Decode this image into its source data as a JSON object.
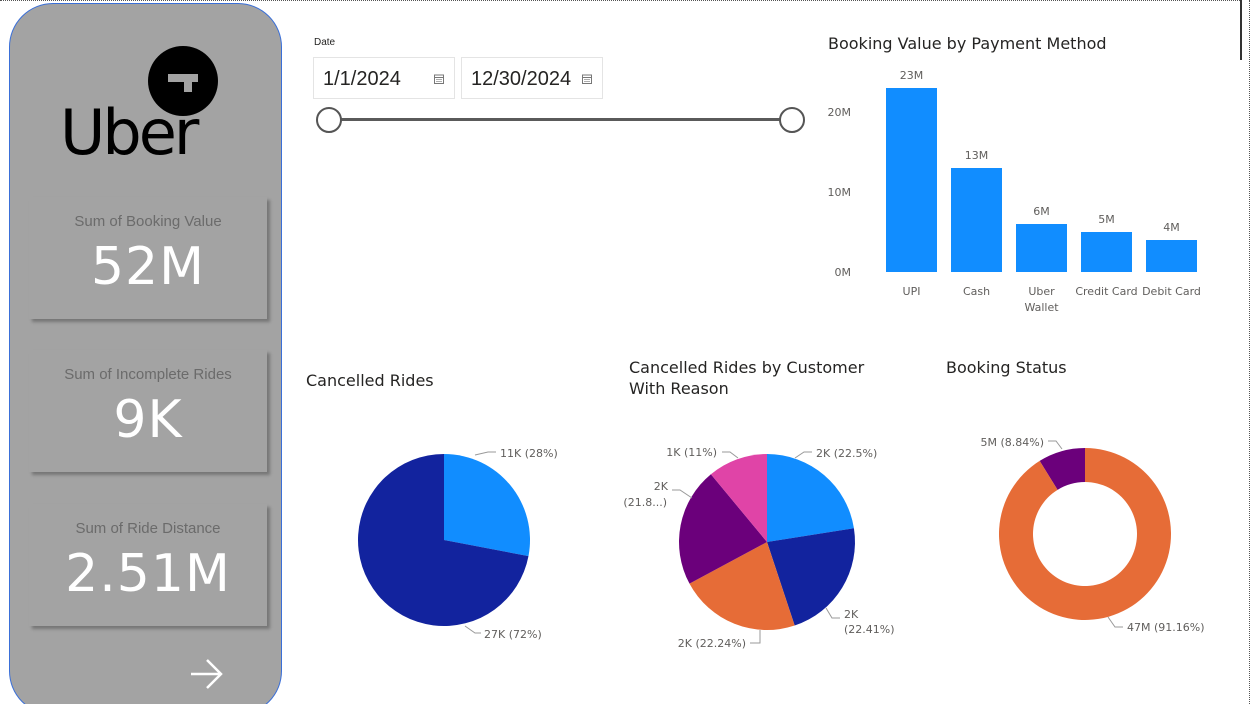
{
  "sidebar": {
    "logo_text": "Uber",
    "kpis": [
      {
        "label": "Sum of Booking Value",
        "value": "52M"
      },
      {
        "label": "Sum of Incomplete Rides",
        "value": "9K"
      },
      {
        "label": "Sum of Ride Distance",
        "value": "2.51M"
      }
    ],
    "nav_icon": "arrow-right-icon"
  },
  "date_slicer": {
    "label": "Date",
    "start": "1/1/2024",
    "end": "12/30/2024",
    "icon": "calendar-icon"
  },
  "colors": {
    "sidebar": "#a3a3a3",
    "bar": "#118dff",
    "navy": "#12239e",
    "orange": "#e66c37",
    "purple": "#6b007b",
    "pink": "#e044a7"
  },
  "chart_data": [
    {
      "type": "bar",
      "title": "Booking Value by Payment Method",
      "categories": [
        "UPI",
        "Cash",
        "Uber Wallet",
        "Credit Card",
        "Debit Card"
      ],
      "category_lines": [
        [
          "UPI"
        ],
        [
          "Cash"
        ],
        [
          "Uber",
          "Wallet"
        ],
        [
          "Credit Card"
        ],
        [
          "Debit Card"
        ]
      ],
      "values": [
        23,
        13,
        6,
        5,
        4
      ],
      "data_labels": [
        "23M",
        "13M",
        "6M",
        "5M",
        "4M"
      ],
      "y_ticks": [
        0,
        10,
        20
      ],
      "y_tick_labels": [
        "0M",
        "10M",
        "20M"
      ],
      "ylim": [
        0,
        23
      ],
      "grid": false
    },
    {
      "type": "pie",
      "title": "Cancelled Rides",
      "slices": [
        {
          "value": 28,
          "label": "11K (28%)",
          "color": "#118dff"
        },
        {
          "value": 72,
          "label": "27K (72%)",
          "color": "#12239e"
        }
      ]
    },
    {
      "type": "pie",
      "title": "Cancelled Rides by Customer With Reason",
      "title_lines": [
        "Cancelled Rides by Customer",
        "With Reason"
      ],
      "slices": [
        {
          "value": 22.5,
          "label_lines": [
            "2K (22.5%)"
          ],
          "color": "#118dff"
        },
        {
          "value": 22.41,
          "label_lines": [
            "2K",
            "(22.41%)"
          ],
          "color": "#12239e"
        },
        {
          "value": 22.24,
          "label_lines": [
            "2K (22.24%)"
          ],
          "color": "#e66c37"
        },
        {
          "value": 21.85,
          "label_lines": [
            "2K",
            "(21.8...)"
          ],
          "color": "#6b007b"
        },
        {
          "value": 11,
          "label_lines": [
            "1K (11%)"
          ],
          "color": "#e044a7"
        }
      ]
    },
    {
      "type": "donut",
      "title": "Booking Status",
      "slices": [
        {
          "value": 91.16,
          "label": "47M (91.16%)",
          "color": "#e66c37"
        },
        {
          "value": 8.84,
          "label": "5M (8.84%)",
          "color": "#6b007b"
        }
      ]
    }
  ]
}
